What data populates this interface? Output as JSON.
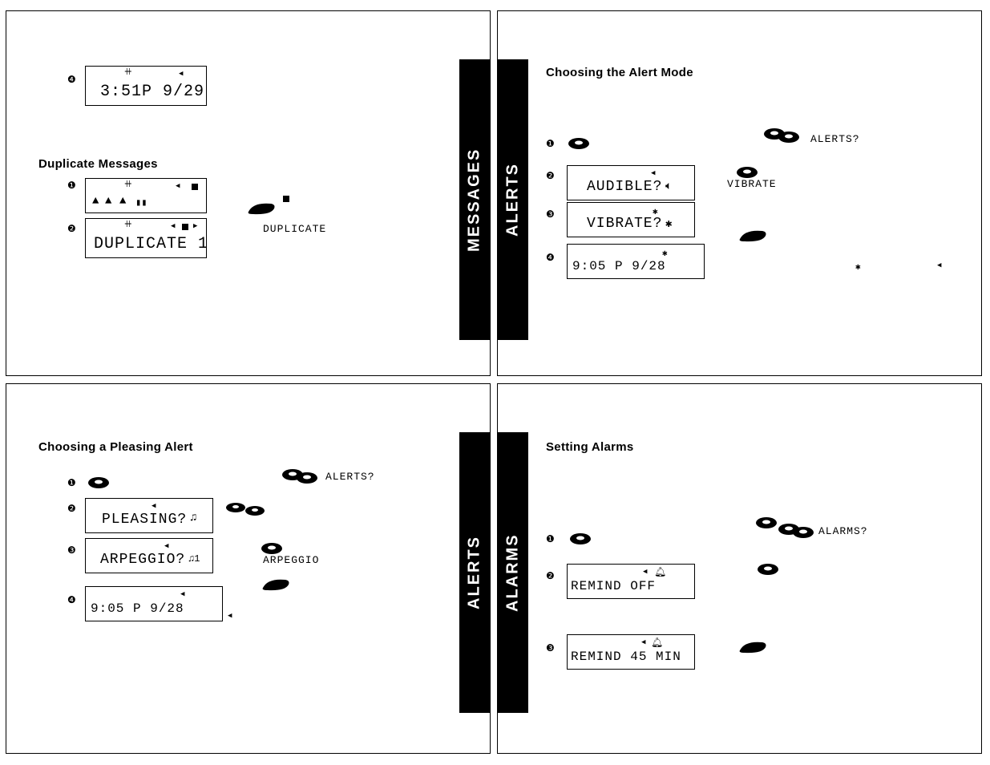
{
  "panels": {
    "topLeft": {
      "tab": "MESSAGES",
      "step4": "❹",
      "lcd_time": "3:51P 9/29",
      "heading": "Duplicate Messages",
      "step1": "❶",
      "step2": "❷",
      "lcd_dup": "DUPLICATE 1",
      "caption_dup": "DUPLICATE"
    },
    "topRight": {
      "tab": "ALERTS",
      "heading": "Choosing the Alert Mode",
      "step1": "❶",
      "step2": "❷",
      "step3": "❸",
      "step4": "❹",
      "caption_alerts": "ALERTS?",
      "caption_vibrate": "VIBRATE",
      "lcd_audible": "AUDIBLE?",
      "lcd_vibrate": "VIBRATE?",
      "lcd_time": "9:05  P     9/28"
    },
    "bottomLeft": {
      "tab": "ALERTS",
      "heading": "Choosing a Pleasing Alert",
      "step1": "❶",
      "step2": "❷",
      "step3": "❸",
      "step4": "❹",
      "caption_alerts": "ALERTS?",
      "caption_arp": "ARPEGGIO",
      "lcd_pleasing": "PLEASING?",
      "lcd_arp": "ARPEGGIO?",
      "lcd_time": "9:05  P     9/28"
    },
    "bottomRight": {
      "tab": "ALARMS",
      "heading": "Setting Alarms",
      "step1": "❶",
      "step2": "❷",
      "step3": "❸",
      "caption_alarms": "ALARMS?",
      "lcd_remind_off": "REMIND OFF",
      "lcd_remind_45": "REMIND   45 MIN"
    }
  }
}
